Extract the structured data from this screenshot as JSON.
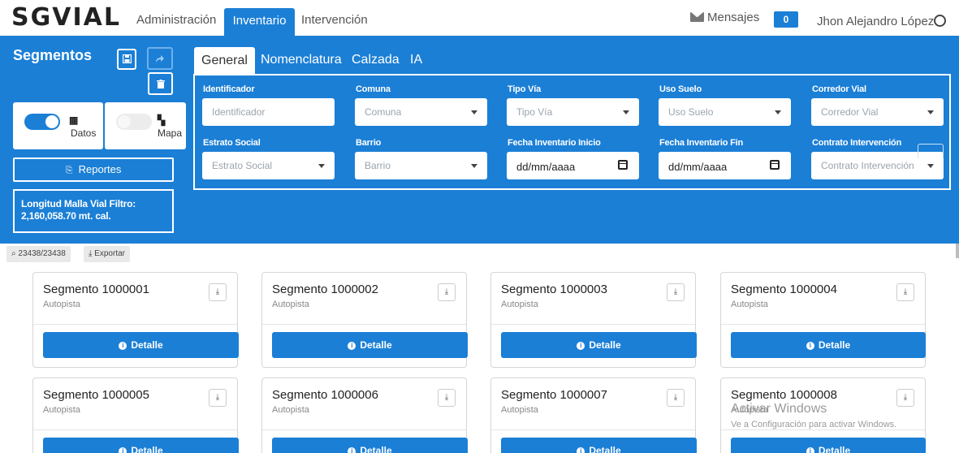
{
  "app": {
    "logo": "SGVIAL"
  },
  "nav": {
    "links": [
      "Administración",
      "Inventario",
      "Intervención"
    ],
    "active": "Inventario",
    "messages_label": "Mensajes",
    "messages_count": "0",
    "user": "Jhon Alejandro López"
  },
  "sidebar": {
    "title": "Segmentos",
    "save_icon": "save-icon",
    "redo_icon": "redo-icon",
    "delete_icon": "trash-icon",
    "views": [
      {
        "label": "Datos",
        "icon": "calendar-icon",
        "on": true
      },
      {
        "label": "Mapa",
        "icon": "map-icon",
        "on": false
      }
    ],
    "reports_label": "Reportes",
    "length_label": "Longitud Malla Vial Filtro:",
    "length_value": "2,160,058.70 mt. cal."
  },
  "filter_tabs": [
    "General",
    "Nomenclatura",
    "Calzada",
    "IA"
  ],
  "filters": [
    {
      "label": "Identificador",
      "placeholder": "Identificador",
      "type": "text"
    },
    {
      "label": "Comuna",
      "placeholder": "Comuna",
      "type": "select"
    },
    {
      "label": "Tipo Vía",
      "placeholder": "Tipo Vía",
      "type": "select"
    },
    {
      "label": "Uso Suelo",
      "placeholder": "Uso Suelo",
      "type": "select"
    },
    {
      "label": "Corredor Vial",
      "placeholder": "Corredor Vial",
      "type": "select"
    },
    {
      "label": "Estrato Social",
      "placeholder": "Estrato Social",
      "type": "select"
    },
    {
      "label": "Barrio",
      "placeholder": "Barrio",
      "type": "select"
    },
    {
      "label": "Fecha Inventario Inicio",
      "value": "dd/mm/aaaa",
      "type": "date"
    },
    {
      "label": "Fecha Inventario Fin",
      "value": "dd/mm/aaaa",
      "type": "date"
    },
    {
      "label": "Contrato Intervención",
      "placeholder": "Contrato Intervención",
      "type": "select"
    }
  ],
  "toolbar": {
    "count": "23438/23438",
    "export_label": "Exportar"
  },
  "cards": [
    {
      "title": "Segmento 1000001",
      "subtitle": "Autopista"
    },
    {
      "title": "Segmento 1000002",
      "subtitle": "Autopista"
    },
    {
      "title": "Segmento 1000003",
      "subtitle": "Autopista"
    },
    {
      "title": "Segmento 1000004",
      "subtitle": "Autopista"
    },
    {
      "title": "Segmento 1000005",
      "subtitle": "Autopista"
    },
    {
      "title": "Segmento 1000006",
      "subtitle": "Autopista"
    },
    {
      "title": "Segmento 1000007",
      "subtitle": "Autopista"
    },
    {
      "title": "Segmento 1000008",
      "subtitle": "Autopista"
    }
  ],
  "card_button_label": "Detalle",
  "watermark": {
    "title": "Activar Windows",
    "subtitle": "Ve a Configuración para activar Windows."
  },
  "colors": {
    "primary": "#1b7fd6",
    "white": "#ffffff"
  }
}
